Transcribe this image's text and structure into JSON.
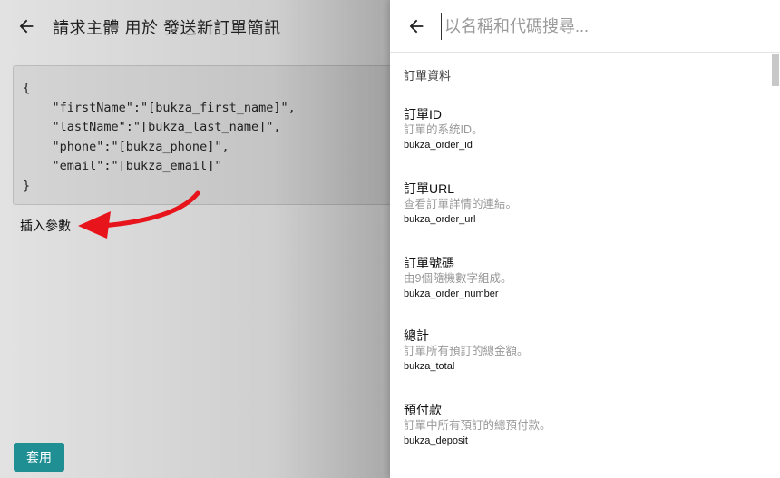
{
  "background": {
    "title": "請求主體 用於 發送新訂單簡訊",
    "code_lines": [
      "{",
      "    \"firstName\":\"[bukza_first_name]\",",
      "    \"lastName\":\"[bukza_last_name]\",",
      "    \"phone\":\"[bukza_phone]\",",
      "    \"email\":\"[bukza_email]\"",
      "}"
    ],
    "insert_param_label": "插入參數",
    "apply_label": "套用",
    "colors": {
      "apply_button": "#1f8f94",
      "annotation_arrow": "#e8141b"
    }
  },
  "panel": {
    "search": {
      "placeholder": "以名稱和代碼搜尋...",
      "value": ""
    },
    "section_label": "訂單資料",
    "items": [
      {
        "title": "訂單ID",
        "desc": "訂單的系統ID。",
        "code": "bukza_order_id"
      },
      {
        "title": "訂單URL",
        "desc": "查看訂單詳情的連結。",
        "code": "bukza_order_url"
      },
      {
        "title": "訂單號碼",
        "desc": "由9個隨機數字組成。",
        "code": "bukza_order_number"
      },
      {
        "title": "總計",
        "desc": "訂單所有預訂的總金額。",
        "code": "bukza_total"
      },
      {
        "title": "預付款",
        "desc": "訂單中所有預訂的總預付款。",
        "code": "bukza_deposit"
      }
    ]
  }
}
